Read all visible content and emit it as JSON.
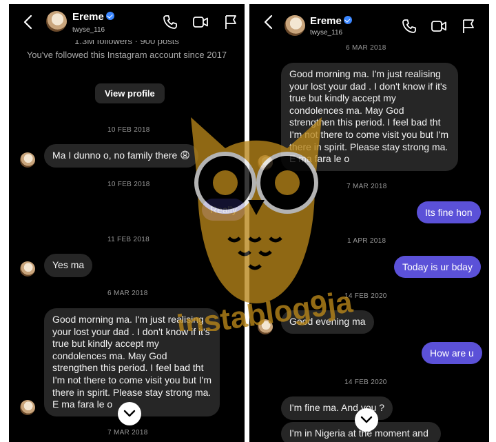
{
  "left": {
    "header": {
      "name": "Ereme",
      "username": "twyse_116"
    },
    "profile": {
      "followers": "1.3M followers · 900 posts",
      "since": "You've followed this Instagram account since 2017",
      "button": "View profile"
    },
    "dates": [
      "10 FEB 2018",
      "10 FEB 2018",
      "11 FEB 2018",
      "6 MAR 2018",
      "7 MAR 2018"
    ],
    "messages": {
      "family": "Ma I dunno o, no family there 😩",
      "really": "Really",
      "yes_ma": "Yes ma",
      "condolence": "Good morning ma. I'm just realising your lost your dad . I don't know if it's true but kindly accept my condolences ma. May God strengthen this period. I feel bad tht I'm not there to come visit you but I'm there in spirit. Please stay strong ma. E ma fara le o"
    }
  },
  "right": {
    "header": {
      "name": "Ereme",
      "username": "twyse_116"
    },
    "dates": [
      "6 MAR 2018",
      "7 MAR 2018",
      "1 APR 2018",
      "14 FEB 2020",
      "14 FEB 2020"
    ],
    "messages": {
      "condolence": "Good morning ma. I'm just realising your lost your dad . I don't know if it's true but kindly accept my condolences ma. May God strengthen this period. I feel bad tht I'm not there to come visit you but I'm there in spirit. Please stay strong ma. E ma fara le o",
      "fine_hon": "Its fine hon",
      "bday": "Today is ur bday",
      "evening": "Good evening ma",
      "how_are_u": "How are u",
      "im_fine": "I'm fine ma. And you ?",
      "nigeria": "I'm in Nigeria at the moment and"
    }
  },
  "watermark": {
    "text": "instablog9ja"
  },
  "colors": {
    "sent_bubble": "#5b51d8",
    "received_bubble": "#262626",
    "background": "#000000",
    "verified": "#3a86ff"
  },
  "icons": [
    "back-arrow-icon",
    "phone-icon",
    "video-icon",
    "flag-icon",
    "verified-badge-icon",
    "chevron-down-icon"
  ]
}
